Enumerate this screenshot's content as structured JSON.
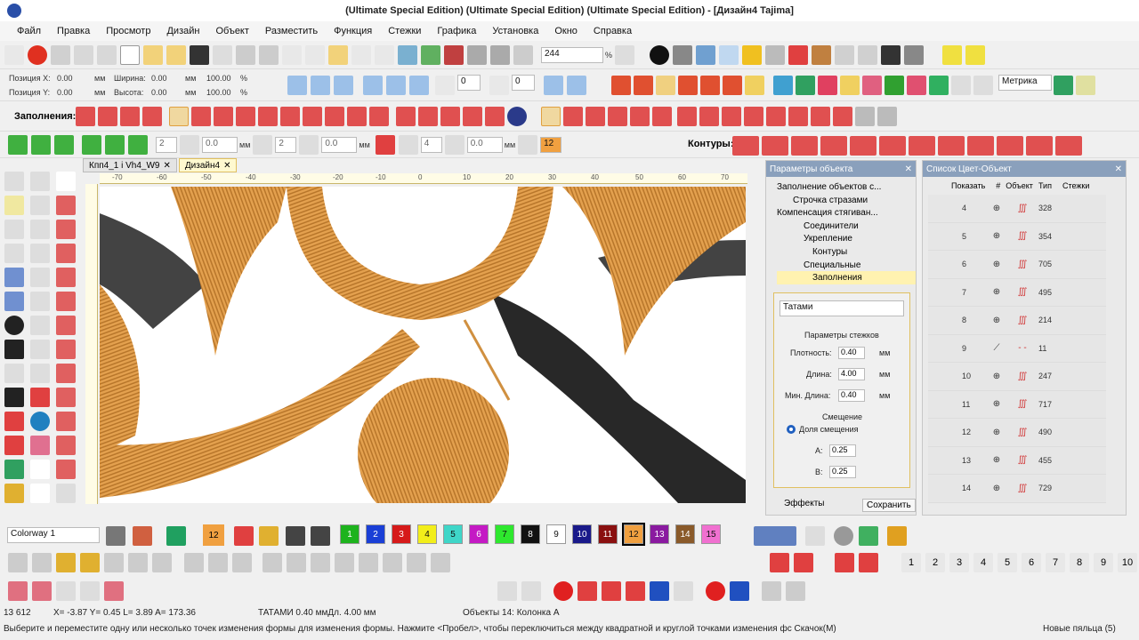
{
  "title": "(Ultimate Special Edition) (Ultimate Special Edition) (Ultimate Special Edition) - [Дизайн4       Tajima]",
  "menu": [
    "Файл",
    "Правка",
    "Просмотр",
    "Дизайн",
    "Объект",
    "Разместить",
    "Функция",
    "Стежки",
    "Графика",
    "Установка",
    "Окно",
    "Справка"
  ],
  "toolbar1": {
    "zoom_value": "244",
    "zoom_unit": "%",
    "units_select": "Метрика"
  },
  "position": {
    "pos_x_label": "Позиция X:",
    "pos_x": "0.00",
    "pos_y_label": "Позиция Y:",
    "pos_y": "0.00",
    "width_label": "Ширина:",
    "width": "0.00",
    "height_label": "Высота:",
    "height": "0.00",
    "pct1": "100.00",
    "pct2": "100.00",
    "pct_unit": "%",
    "mm": "мм"
  },
  "fills_label": "Заполнения:",
  "contours_label": "Контуры:",
  "rotation": {
    "angle1": "0",
    "angle2": "0"
  },
  "spinners": {
    "s1": "2",
    "s2": "0.0",
    "s3": "2",
    "s4": "0.0",
    "s5": "4",
    "s6": "0.0",
    "s7": "12",
    "unit": "мм"
  },
  "tabs": [
    {
      "label": "Кпп4_1 i Vh4_W9"
    },
    {
      "label": "Дизайн4"
    }
  ],
  "ruler_ticks": [
    "-70",
    "-60",
    "-50",
    "-40",
    "-30",
    "-20",
    "-10",
    "0",
    "10",
    "20",
    "30",
    "40",
    "50",
    "60",
    "70"
  ],
  "obj_params": {
    "title": "Параметры объекта",
    "tree": [
      "Заполнение объектов с...",
      "Строчка стразами",
      "Компенсация стягиван...",
      "Соединители",
      "Укрепление",
      "Контуры",
      "Специальные",
      "Заполнения"
    ],
    "fill_type": "Татами",
    "stitch_params": "Параметры стежков",
    "density_label": "Плотность:",
    "density": "0.40",
    "length_label": "Длина:",
    "length": "4.00",
    "min_length_label": "Мин. Длина:",
    "min_length": "0.40",
    "offset_label": "Смещение",
    "offset_fraction": "Доля смещения",
    "a_label": "A:",
    "a": "0.25",
    "b_label": "B:",
    "b": "0.25",
    "mm": "мм",
    "effects_btn": "Эффекты",
    "save_btn": "Сохранить"
  },
  "color_list": {
    "title": "Список Цвет-Объект",
    "show_btn": "Показать",
    "cols": [
      "#",
      "Объект",
      "Тип",
      "Стежки"
    ],
    "rows": [
      {
        "n": "4",
        "stitches": "328"
      },
      {
        "n": "5",
        "stitches": "354"
      },
      {
        "n": "6",
        "stitches": "705"
      },
      {
        "n": "7",
        "stitches": "495"
      },
      {
        "n": "8",
        "stitches": "214"
      },
      {
        "n": "9",
        "stitches": "11"
      },
      {
        "n": "10",
        "stitches": "247"
      },
      {
        "n": "11",
        "stitches": "717"
      },
      {
        "n": "12",
        "stitches": "490"
      },
      {
        "n": "13",
        "stitches": "455"
      },
      {
        "n": "14",
        "stitches": "729"
      }
    ]
  },
  "colorway": {
    "select": "Colorway 1",
    "current": "12"
  },
  "palette": [
    {
      "n": "1",
      "c": "#1db31d"
    },
    {
      "n": "2",
      "c": "#1a3fd6"
    },
    {
      "n": "3",
      "c": "#d61a1a"
    },
    {
      "n": "4",
      "c": "#f2ee1a"
    },
    {
      "n": "5",
      "c": "#3fd6c8"
    },
    {
      "n": "6",
      "c": "#c41ac4"
    },
    {
      "n": "7",
      "c": "#2ee82e"
    },
    {
      "n": "8",
      "c": "#111111"
    },
    {
      "n": "9",
      "c": "#ffffff"
    },
    {
      "n": "10",
      "c": "#1a1a8a"
    },
    {
      "n": "11",
      "c": "#8a1010"
    },
    {
      "n": "12",
      "c": "#f0a040"
    },
    {
      "n": "13",
      "c": "#8a1aa0"
    },
    {
      "n": "14",
      "c": "#8a5a2a"
    },
    {
      "n": "15",
      "c": "#f070d0"
    }
  ],
  "seq_numbers": [
    "1",
    "2",
    "3",
    "4",
    "5",
    "6",
    "7",
    "8",
    "9",
    "10"
  ],
  "status": {
    "line1_count": "13 612",
    "line1_coords": "X=  -3.87 Y=   0.45 L=   3.89 A= 173.36",
    "line1_info": "ТАТАМИ  0.40 ммДл.  4.00 мм",
    "line1_objects": "Объекты 14: Колонка A",
    "line2": "Выберите и переместите одну или несколько точек изменения формы для изменения формы. Нажмите <Пробел>, чтобы переключиться между квадратной и круглой точками изменения фс  Скачок(М)",
    "hoop": "Новые пяльца (5)"
  },
  "colors": {
    "thread": "#e0a050",
    "accent": "#c8d0e0",
    "panel_header": "#8aa0bc"
  }
}
